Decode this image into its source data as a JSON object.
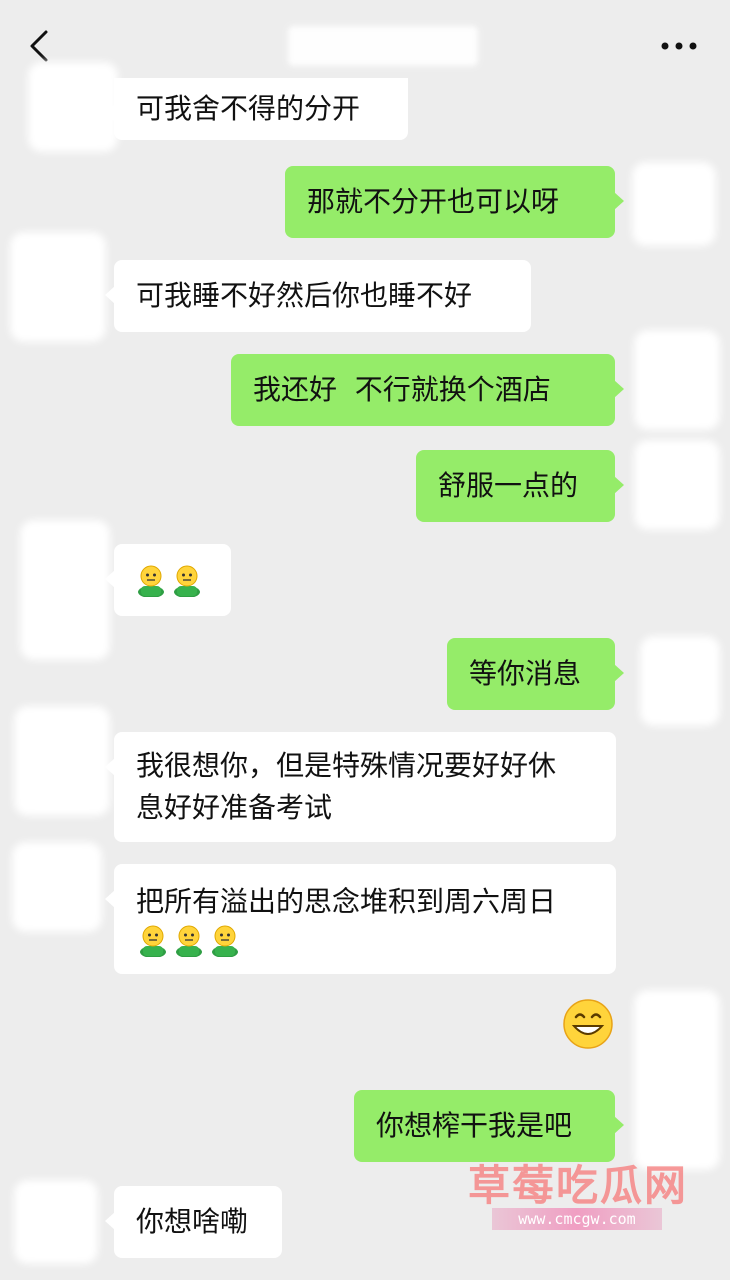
{
  "colors": {
    "background": "#ededed",
    "incoming_bubble": "#ffffff",
    "outgoing_bubble": "#95ec69",
    "text": "#111111"
  },
  "header": {
    "back_icon": "chevron-left-icon",
    "more_icon": "more-dots-icon"
  },
  "messages": [
    {
      "side": "in",
      "text": "可我舍不得的分开"
    },
    {
      "side": "out",
      "text": "那就不分开也可以呀"
    },
    {
      "side": "in",
      "text": "可我睡不好然后你也睡不好"
    },
    {
      "side": "out",
      "text": "我还好  不行就换个酒店"
    },
    {
      "side": "out",
      "text": "舒服一点的"
    },
    {
      "side": "in",
      "emoji": [
        "guy-icon",
        "guy-icon"
      ]
    },
    {
      "side": "out",
      "text": "等你消息"
    },
    {
      "side": "in",
      "lines": [
        "我很想你，但是特殊情况要好好休",
        "息好好准备考试"
      ]
    },
    {
      "side": "in",
      "text": "把所有溢出的思念堆积到周六周日",
      "emoji": [
        "guy-icon",
        "guy-icon",
        "guy-icon"
      ]
    },
    {
      "side": "out",
      "emoji": [
        "grin-icon"
      ]
    },
    {
      "side": "out",
      "text": "你想榨干我是吧"
    },
    {
      "side": "in",
      "text": "你想啥嘞"
    }
  ],
  "watermark": {
    "title": "草莓吃瓜网",
    "url": "www.cmcgw.com"
  }
}
